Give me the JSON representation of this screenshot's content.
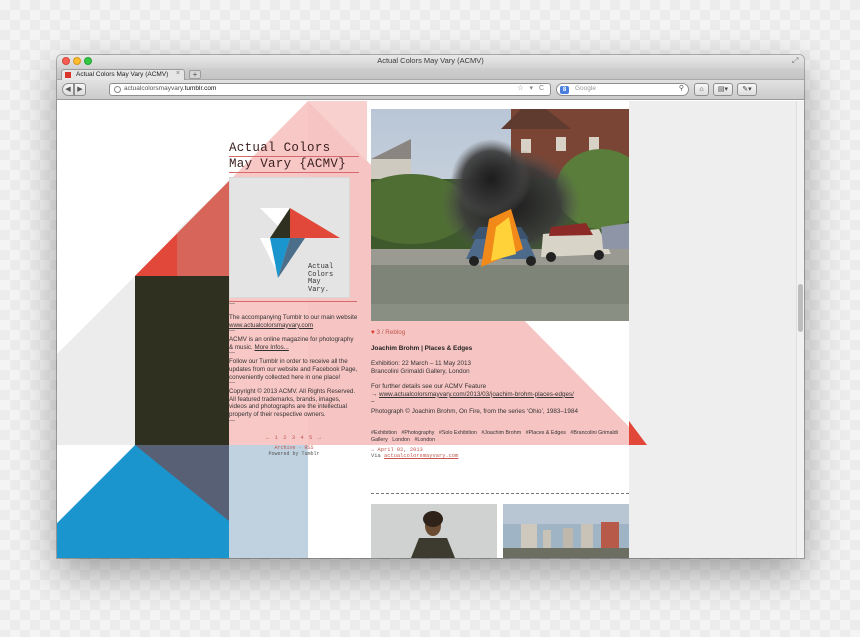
{
  "window": {
    "title": "Actual Colors May Vary (ACMV)"
  },
  "tab": {
    "label": "Actual Colors May Vary (ACMV)",
    "close_icon": "×",
    "new_tab_icon": "+"
  },
  "toolbar": {
    "url_prefix": "actualcolorsmayvary.",
    "url_domain": "tumblr.com",
    "url_icons": "☆ ▾ C",
    "search_engine_badge": "8",
    "search_placeholder": "Google",
    "search_icon": "⚲",
    "home_icon": "⌂",
    "bookmarks_icon": "▤▾",
    "tools_icon": "✎▾",
    "back_icon": "◀",
    "forward_icon": "▶"
  },
  "sidebar": {
    "title_line1": "Actual Colors",
    "title_line2": "May Vary {ACMV}",
    "logo_text_line1": "Actual",
    "logo_text_line2": "Colors",
    "logo_text_line3": "May",
    "logo_text_line4": "Vary.",
    "p1_text": "The accompanying Tumblr to our main website ",
    "p1_link": "www.actualcolorsmayvary.com",
    "p2_text": "ACMV is an online magazine for photography & music. ",
    "p2_link": "More Infos...",
    "p3": "Follow our Tumblr in order to receive all the updates from our website and Facebook Page, conveniently collected here in one place!",
    "p4": "Copyright © 2013 ACMV. All Rights Reserved. All featured trademarks, brands, images, videos and photographs are the intellectual property of their respective owners.",
    "dash": "—",
    "pager": "← 1 2 3 4 5 →",
    "archive_link": "Archive",
    "rss_link": "RSS",
    "powered_by": "Powered by Tumblr"
  },
  "post": {
    "notes_count": "3",
    "heart_icon": "♥",
    "meta_sep": "/",
    "reblog_label": "Reblog",
    "title": "Joachim Brohm | Places & Edges",
    "exhibition_line1": "Exhibition: 22 March – 11 May 2013",
    "exhibition_line2": "Brancolini Grimaldi Gallery, London",
    "details_text": "For further details see our ACMV Feature",
    "details_arrow": "→",
    "details_link": "www.actualcolorsmayvary.com/2013/03/joachim-brohm-places-edges/",
    "dash": "–",
    "caption": "Photograph © Joachim Brohm, On Fire, from the series ‘Ohio’, 1983–1984",
    "tags": [
      "#Exhibition",
      "#Photography",
      "#Solo Exhibition",
      "#Joachim Brohm",
      "#Places & Edges",
      "#Brancolini Grimaldi Gallery",
      "London",
      "#London"
    ],
    "date_arrow": "→",
    "date": "April 02, 2013",
    "via_label": "Via",
    "via_link": "actualcolorsmayvary.com"
  },
  "colors": {
    "red": "#e2483a",
    "dark_olive": "#2f301f",
    "blue": "#1b95cd",
    "pink": "#f3b5b3",
    "link_red": "#c2574f"
  }
}
